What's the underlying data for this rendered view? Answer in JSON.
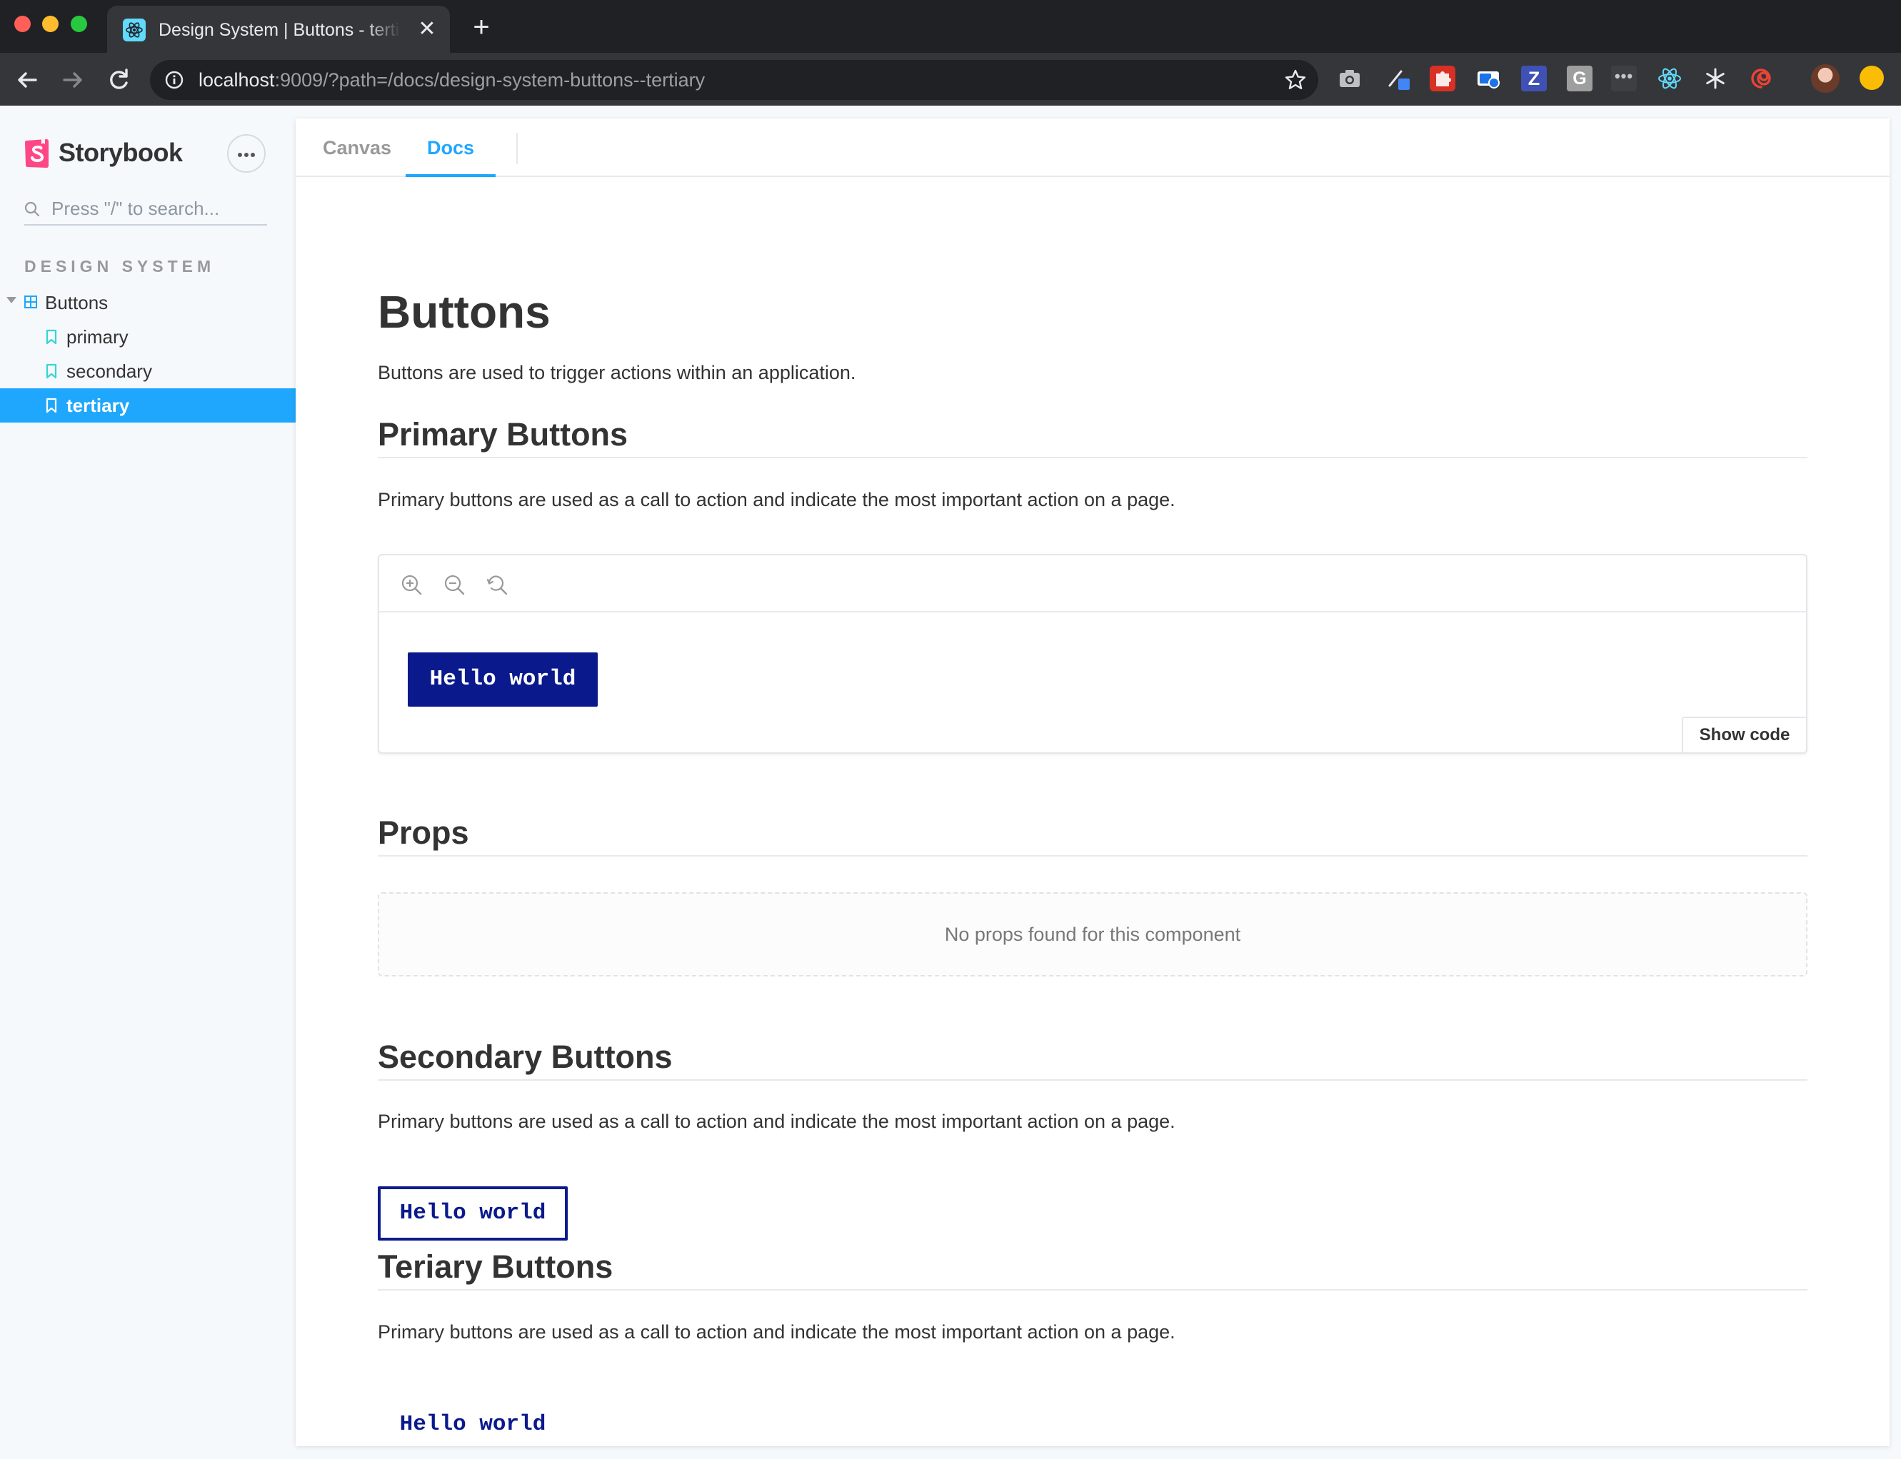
{
  "browser": {
    "tab_title": "Design System | Buttons - tertiary",
    "tab_close": "✕",
    "new_tab": "+",
    "url_host": "localhost",
    "url_rest": ":9009/?path=/docs/design-system-buttons--tertiary",
    "extensions": {
      "z_label": "Z",
      "g_label": "G",
      "dots_label": "•••"
    }
  },
  "sidebar": {
    "title": "Storybook",
    "search_placeholder": "Press \"/\" to search...",
    "section": "DESIGN SYSTEM",
    "tree": [
      {
        "label": "Buttons",
        "type": "component",
        "expanded": true
      },
      {
        "label": "primary",
        "type": "story"
      },
      {
        "label": "secondary",
        "type": "story"
      },
      {
        "label": "tertiary",
        "type": "story",
        "selected": true
      }
    ]
  },
  "tabs": {
    "canvas": "Canvas",
    "docs": "Docs",
    "active": "Docs"
  },
  "doc": {
    "title": "Buttons",
    "intro": "Buttons are used to trigger actions within an application.",
    "primary": {
      "heading": "Primary Buttons",
      "description": "Primary buttons are used as a call to action and indicate the most important action on a page.",
      "button_label": "Hello world",
      "show_code": "Show code"
    },
    "props": {
      "heading": "Props",
      "empty": "No props found for this component"
    },
    "secondary": {
      "heading": "Secondary Buttons",
      "description": "Primary buttons are used as a call to action and indicate the most important action on a page.",
      "button_label": "Hello world"
    },
    "tertiary": {
      "heading": "Teriary Buttons",
      "description": "Primary buttons are used as a call to action and indicate the most important action on a page.",
      "button_label": "Hello world"
    }
  },
  "colors": {
    "accent": "#1ea7fd",
    "storybook_pink": "#ff4785",
    "button_navy": "#0a1a8c",
    "story_icon": "#37d5d3"
  }
}
